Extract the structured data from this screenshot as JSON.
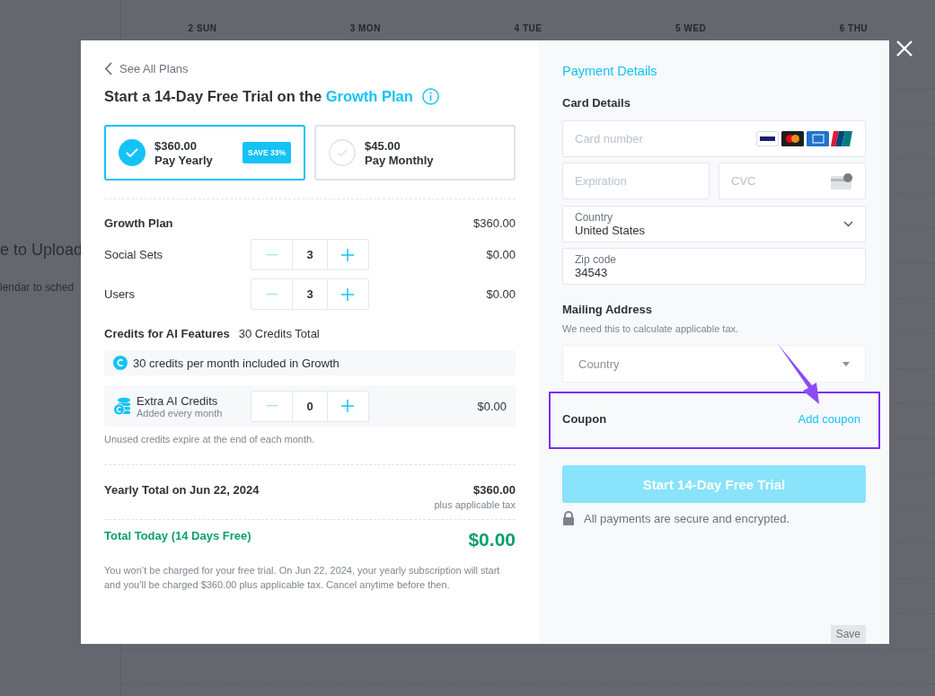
{
  "background": {
    "sidebar_texts": [
      "e to Upload",
      "lendar to sched"
    ],
    "days": [
      "2 SUN",
      "3 MON",
      "4 TUE",
      "5 WED",
      "6 THU"
    ],
    "save_button": "Save"
  },
  "plan_panel": {
    "back_link": "See All Plans",
    "title_prefix": "Start a 14-Day Free Trial on the",
    "title_highlight": "Growth Plan",
    "plans": [
      {
        "price": "$360.00",
        "label": "Pay Yearly",
        "badge": "SAVE 33%",
        "selected": true
      },
      {
        "price": "$45.00",
        "label": "Pay Monthly",
        "selected": false
      }
    ],
    "plan_name": "Growth Plan",
    "plan_price": "$360.00",
    "quantities": [
      {
        "label": "Social Sets",
        "value": "3",
        "price": "$0.00"
      },
      {
        "label": "Users",
        "value": "3",
        "price": "$0.00"
      }
    ],
    "credits": {
      "heading": "Credits for AI Features",
      "total": "30 Credits Total",
      "included": "30 credits per month included in Growth",
      "extra_label": "Extra AI Credits",
      "extra_sub": "Added every month",
      "extra_value": "0",
      "extra_price": "$0.00",
      "note": "Unused credits expire at the end of each month."
    },
    "yearly": {
      "label": "Yearly Total on Jun 22, 2024",
      "amount": "$360.00",
      "tax": "plus applicable tax"
    },
    "today": {
      "label": "Total Today (14 Days Free)",
      "amount": "$0.00"
    },
    "disclaimer": "You won’t be charged for your free trial. On Jun 22, 2024, your yearly subscription will start and you’ll be charged $360.00 plus applicable tax. Cancel anytime before then."
  },
  "payment_panel": {
    "heading": "Payment Details",
    "card_heading": "Card Details",
    "card_number": {
      "placeholder": "Card number"
    },
    "expiration": {
      "placeholder": "Expiration"
    },
    "cvc": {
      "placeholder": "CVC"
    },
    "country": {
      "label": "Country",
      "value": "United States"
    },
    "zip": {
      "label": "Zip code",
      "value": "34543"
    },
    "mailing_heading": "Mailing Address",
    "mailing_note": "We need this to calculate applicable tax.",
    "mailing_country": {
      "placeholder": "Country"
    },
    "coupon": {
      "label": "Coupon",
      "link": "Add coupon"
    },
    "submit": {
      "label": "Start 14-Day Free Trial",
      "disabled": true
    },
    "secure_note": "All payments are secure and encrypted."
  }
}
